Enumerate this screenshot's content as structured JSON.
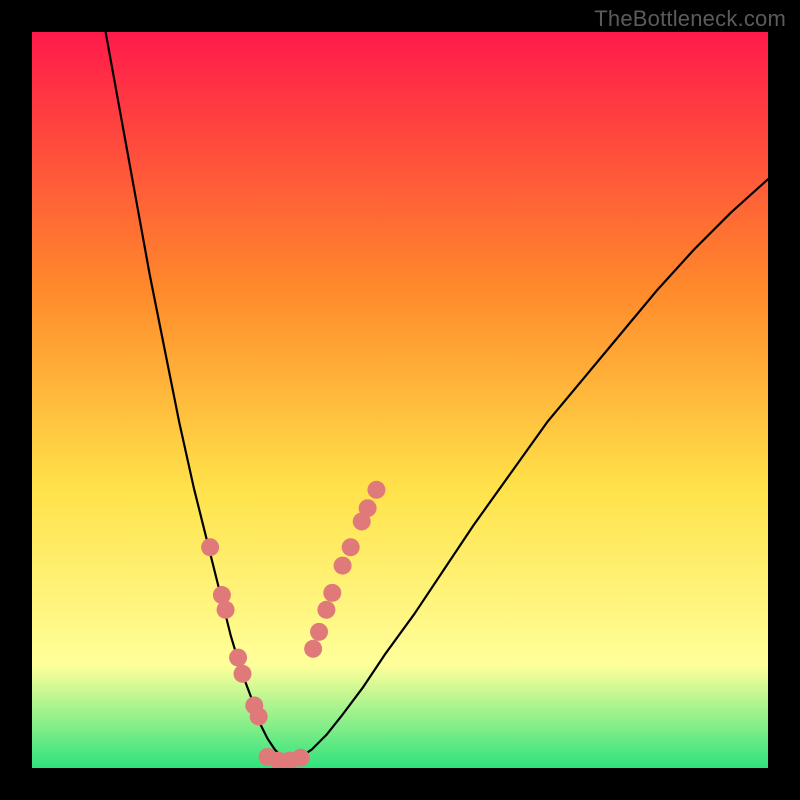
{
  "watermark": "TheBottleneck.com",
  "chart_data": {
    "type": "line",
    "title": "",
    "xlabel": "",
    "ylabel": "",
    "xlim": [
      0,
      100
    ],
    "ylim": [
      0,
      100
    ],
    "grid": false,
    "legend": false,
    "background_gradient": {
      "top": "#ff1a4b",
      "mid1": "#ff8a2b",
      "mid2": "#ffe24a",
      "mid3": "#ffff9a",
      "bottom": "#2fe27d"
    },
    "series": [
      {
        "name": "left-curve",
        "stroke": "#000000",
        "x": [
          10,
          12,
          14,
          16,
          18,
          20,
          22,
          24,
          25.5,
          27,
          28.5,
          30,
          31,
          32,
          33,
          34,
          35
        ],
        "y": [
          100,
          89,
          78,
          67,
          57,
          47,
          38,
          30,
          24,
          18,
          13,
          9,
          6,
          4,
          2.5,
          1.5,
          1
        ]
      },
      {
        "name": "right-curve",
        "stroke": "#000000",
        "x": [
          35,
          36.5,
          38,
          40,
          42,
          45,
          48,
          52,
          56,
          60,
          65,
          70,
          75,
          80,
          85,
          90,
          95,
          100
        ],
        "y": [
          1,
          1.5,
          2.5,
          4.5,
          7,
          11,
          15.5,
          21,
          27,
          33,
          40,
          47,
          53,
          59,
          65,
          70.5,
          75.5,
          80
        ]
      },
      {
        "name": "left-dots",
        "type": "scatter",
        "color": "#e07a7a",
        "x": [
          24.2,
          25.8,
          26.3,
          28.0,
          28.6,
          30.2,
          30.8
        ],
        "y": [
          30.0,
          23.5,
          21.5,
          15.0,
          12.8,
          8.5,
          7.0
        ]
      },
      {
        "name": "right-dots",
        "type": "scatter",
        "color": "#e07a7a",
        "x": [
          38.2,
          39.0,
          40.0,
          40.8,
          42.2,
          43.3,
          44.8,
          45.6,
          46.8
        ],
        "y": [
          16.2,
          18.5,
          21.5,
          23.8,
          27.5,
          30.0,
          33.5,
          35.3,
          37.8
        ]
      },
      {
        "name": "bottom-dots",
        "type": "scatter",
        "color": "#e07a7a",
        "x": [
          32.0,
          33.5,
          35.0,
          36.5
        ],
        "y": [
          1.5,
          1.0,
          1.0,
          1.4
        ]
      }
    ]
  }
}
